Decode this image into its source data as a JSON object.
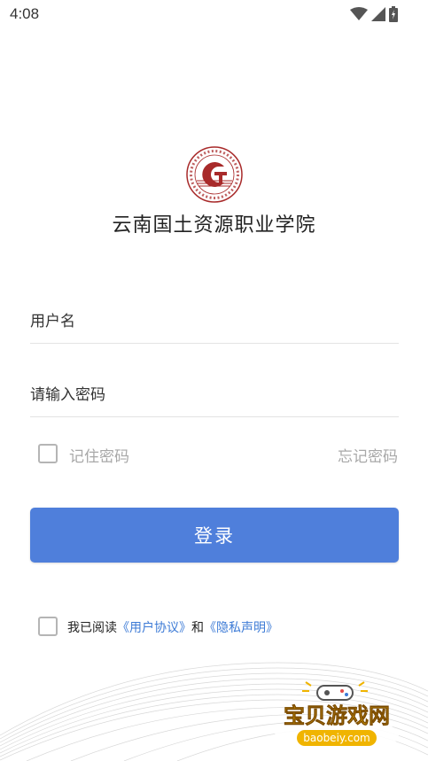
{
  "status_bar": {
    "time": "4:08",
    "icons": [
      "wifi-icon",
      "signal-icon",
      "battery-icon"
    ]
  },
  "header": {
    "logo": "school-emblem-logo",
    "school_name": "云南国土资源职业学院"
  },
  "form": {
    "username_placeholder": "用户名",
    "password_placeholder": "请输入密码",
    "remember_label": "记住密码",
    "forgot_label": "忘记密码",
    "login_label": "登录"
  },
  "agreement": {
    "prefix": "我已阅读",
    "user_agreement": "《用户协议》",
    "and": "和",
    "privacy": "《隐私声明》"
  },
  "watermark": {
    "title": "宝贝游戏网",
    "url": "baobeiy.com"
  },
  "colors": {
    "accent": "#4f7fdb",
    "link": "#3d7bd6",
    "logo_red": "#a82a2a"
  }
}
